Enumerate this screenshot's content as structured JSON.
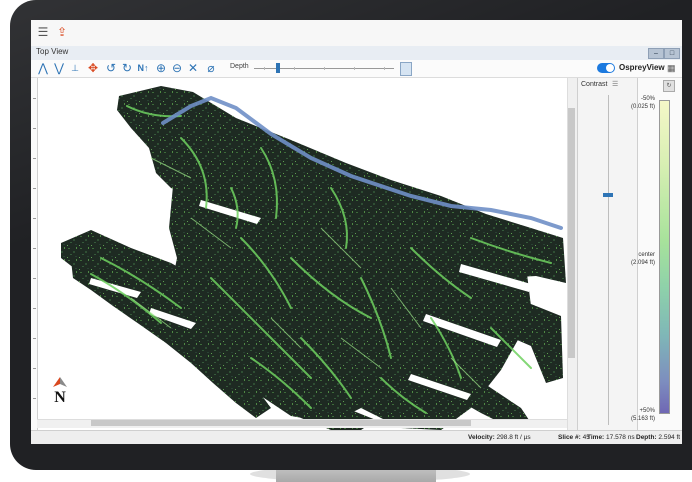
{
  "window": {
    "title": "Top View"
  },
  "toolbar": {
    "depth_label": "Depth"
  },
  "osprey": {
    "label": "OspreyView",
    "toggle_on": true
  },
  "contrast": {
    "label": "Contrast"
  },
  "scale": {
    "top_pct": "-50%",
    "top_value": "(0.025 ft)",
    "center_label": "center",
    "center_value": "(2.094 ft)",
    "bottom_pct": "+50%",
    "bottom_value": "(5.163 ft)"
  },
  "status": {
    "velocity_label": "Velocity:",
    "velocity_value": "298.8 ft / µs",
    "slice_label": "Slice #:",
    "slice_value": "45",
    "time_label": "Time:",
    "time_value": "17.578 ns",
    "depth_label": "Depth:",
    "depth_value": "2.594 ft"
  },
  "compass": {
    "letter": "N"
  },
  "icons": {
    "app_menu": "menu-icon",
    "app_export": "export-icon",
    "tools": [
      "chevron-up-icon",
      "chevron-down-icon",
      "ruler-icon",
      "crosshair-icon",
      "rotate-left-icon",
      "rotate-right-icon",
      "north-up-icon",
      "zoom-in-icon",
      "zoom-out-icon",
      "fit-icon",
      "eraser-icon"
    ]
  },
  "colors": {
    "accent": "#1d7adf",
    "map_base": "#1d2b1f",
    "map_highlight": "#6fd160",
    "pipe_line": "#6f8fc7"
  }
}
